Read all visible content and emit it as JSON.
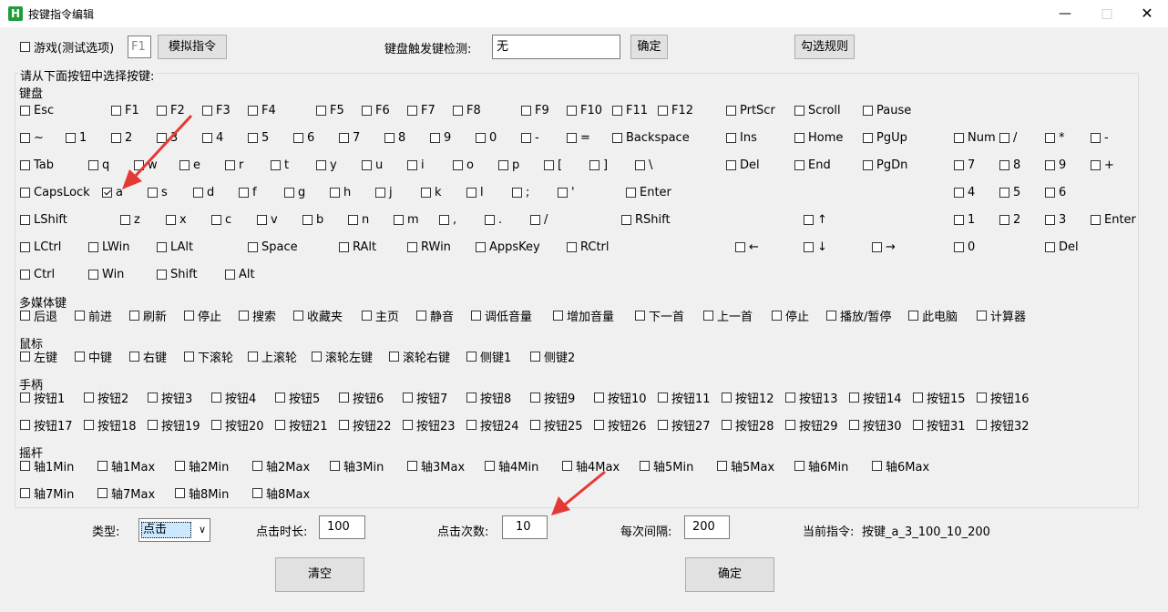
{
  "window": {
    "title": "按键指令编辑"
  },
  "top": {
    "game_checkbox": "游戏(测试选项)",
    "f1_box": "F1",
    "simulate_btn": "模拟指令",
    "detect_label": "键盘触发键检测:",
    "detect_value": "无",
    "confirm_btn": "确定",
    "select_rule_btn": "勾选规则"
  },
  "group_title": "请从下面按钮中选择按键:",
  "sections": {
    "keyboard": "键盘",
    "multimedia": "多媒体键",
    "mouse": "鼠标",
    "gamepad": "手柄",
    "joystick": "摇杆"
  },
  "keyboard_rows": [
    [
      "Esc",
      "F1",
      "F2",
      "F3",
      "F4",
      "F5",
      "F6",
      "F7",
      "F8",
      "F9",
      "F10",
      "F11",
      "F12",
      "PrtScr",
      "Scroll",
      "Pause"
    ],
    [
      "~",
      "1",
      "2",
      "3",
      "4",
      "5",
      "6",
      "7",
      "8",
      "9",
      "0",
      "-",
      "=",
      "Backspace",
      "Ins",
      "Home",
      "PgUp",
      "Num",
      "/",
      "*",
      "-"
    ],
    [
      "Tab",
      "q",
      "w",
      "e",
      "r",
      "t",
      "y",
      "u",
      "i",
      "o",
      "p",
      "[",
      "]",
      "\\",
      "Del",
      "End",
      "PgDn",
      "7",
      "8",
      "9",
      "+"
    ],
    [
      "CapsLock",
      "a",
      "s",
      "d",
      "f",
      "g",
      "h",
      "j",
      "k",
      "l",
      ";",
      "'",
      "Enter",
      "4",
      "5",
      "6"
    ],
    [
      "LShift",
      "z",
      "x",
      "c",
      "v",
      "b",
      "n",
      "m",
      ",",
      ".",
      "/",
      "RShift",
      "↑",
      "1",
      "2",
      "3",
      "Enter"
    ],
    [
      "LCtrl",
      "LWin",
      "LAlt",
      "Space",
      "RAlt",
      "RWin",
      "AppsKey",
      "RCtrl",
      "←",
      "↓",
      "→",
      "0",
      "Del"
    ],
    [
      "Ctrl",
      "Win",
      "Shift",
      "Alt"
    ]
  ],
  "multimedia": [
    "后退",
    "前进",
    "刷新",
    "停止",
    "搜索",
    "收藏夹",
    "主页",
    "静音",
    "调低音量",
    "增加音量",
    "下一首",
    "上一首",
    "停止",
    "播放/暂停",
    "此电脑",
    "计算器"
  ],
  "mouse": [
    "左键",
    "中键",
    "右键",
    "下滚轮",
    "上滚轮",
    "滚轮左键",
    "滚轮右键",
    "侧键1",
    "侧键2"
  ],
  "gamepad_row1": [
    "按钮1",
    "按钮2",
    "按钮3",
    "按钮4",
    "按钮5",
    "按钮6",
    "按钮7",
    "按钮8",
    "按钮9",
    "按钮10",
    "按钮11",
    "按钮12",
    "按钮13",
    "按钮14",
    "按钮15",
    "按钮16"
  ],
  "gamepad_row2": [
    "按钮17",
    "按钮18",
    "按钮19",
    "按钮20",
    "按钮21",
    "按钮22",
    "按钮23",
    "按钮24",
    "按钮25",
    "按钮26",
    "按钮27",
    "按钮28",
    "按钮29",
    "按钮30",
    "按钮31",
    "按钮32"
  ],
  "joystick_row1": [
    "轴1Min",
    "轴1Max",
    "轴2Min",
    "轴2Max",
    "轴3Min",
    "轴3Max",
    "轴4Min",
    "轴4Max",
    "轴5Min",
    "轴5Max",
    "轴6Min",
    "轴6Max"
  ],
  "joystick_row2": [
    "轴7Min",
    "轴7Max",
    "轴8Min",
    "轴8Max"
  ],
  "checked_key": "a",
  "bottom": {
    "type_label": "类型:",
    "type_value": "点击",
    "duration_label": "点击时长:",
    "duration_value": "100",
    "count_label": "点击次数:",
    "count_value": "10",
    "interval_label": "每次间隔:",
    "interval_value": "200",
    "current_label": "当前指令:",
    "current_value": "按键_a_3_100_10_200",
    "clear_btn": "清空",
    "ok_btn": "确定"
  },
  "colors": {
    "annotation_arrow": "#e53935",
    "app_icon": "#1e9e3a"
  }
}
